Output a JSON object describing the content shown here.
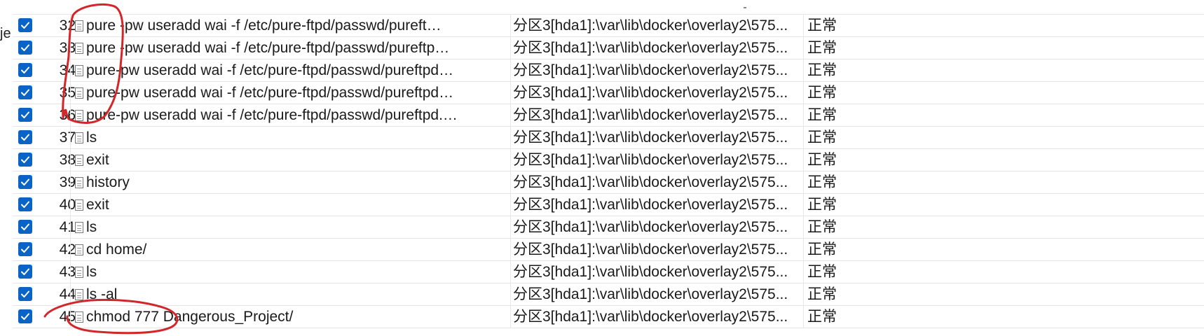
{
  "gutter": {
    "fragment": "je"
  },
  "colors": {
    "checkbox": "#0a64c8",
    "annotation": "#d3262a",
    "grid": "#e5e5e5"
  },
  "icons": {
    "row_icon": "file-icon",
    "check_icon": "checkmark-icon"
  },
  "rows": [
    {
      "checked": true,
      "num": "32",
      "command": "pure   -pw useradd wai -f /etc/pure-ftpd/passwd/pureft…",
      "path": "分区3[hda1]:\\var\\lib\\docker\\overlay2\\575...",
      "status": "正常"
    },
    {
      "checked": true,
      "num": "33",
      "command": "pure   -pw useradd wai -f /etc/pure-ftpd/passwd/pureftp…",
      "path": "分区3[hda1]:\\var\\lib\\docker\\overlay2\\575...",
      "status": "正常"
    },
    {
      "checked": true,
      "num": "34",
      "command": "pure-pw useradd wai -f /etc/pure-ftpd/passwd/pureftpd…",
      "path": "分区3[hda1]:\\var\\lib\\docker\\overlay2\\575...",
      "status": "正常"
    },
    {
      "checked": true,
      "num": "35",
      "command": "pure-pw useradd wai -f /etc/pure-ftpd/passwd/pureftpd…",
      "path": "分区3[hda1]:\\var\\lib\\docker\\overlay2\\575...",
      "status": "正常"
    },
    {
      "checked": true,
      "num": "36",
      "command": "pure-pw useradd wai -f /etc/pure-ftpd/passwd/pureftpd.…",
      "path": "分区3[hda1]:\\var\\lib\\docker\\overlay2\\575...",
      "status": "正常"
    },
    {
      "checked": true,
      "num": "37",
      "command": "ls",
      "path": "分区3[hda1]:\\var\\lib\\docker\\overlay2\\575...",
      "status": "正常"
    },
    {
      "checked": true,
      "num": "38",
      "command": "exit",
      "path": "分区3[hda1]:\\var\\lib\\docker\\overlay2\\575...",
      "status": "正常"
    },
    {
      "checked": true,
      "num": "39",
      "command": "history",
      "path": "分区3[hda1]:\\var\\lib\\docker\\overlay2\\575...",
      "status": "正常"
    },
    {
      "checked": true,
      "num": "40",
      "command": "exit",
      "path": "分区3[hda1]:\\var\\lib\\docker\\overlay2\\575...",
      "status": "正常"
    },
    {
      "checked": true,
      "num": "41",
      "command": "ls",
      "path": "分区3[hda1]:\\var\\lib\\docker\\overlay2\\575...",
      "status": "正常"
    },
    {
      "checked": true,
      "num": "42",
      "command": "cd home/",
      "path": "分区3[hda1]:\\var\\lib\\docker\\overlay2\\575...",
      "status": "正常"
    },
    {
      "checked": true,
      "num": "43",
      "command": "ls",
      "path": "分区3[hda1]:\\var\\lib\\docker\\overlay2\\575...",
      "status": "正常"
    },
    {
      "checked": true,
      "num": "44",
      "command": "ls -al",
      "path": "分区3[hda1]:\\var\\lib\\docker\\overlay2\\575...",
      "status": "正常"
    },
    {
      "checked": true,
      "num": "45",
      "command": "chmod 777 Dangerous_Project/",
      "path": "分区3[hda1]:\\var\\lib\\docker\\overlay2\\575...",
      "status": "正常"
    }
  ]
}
